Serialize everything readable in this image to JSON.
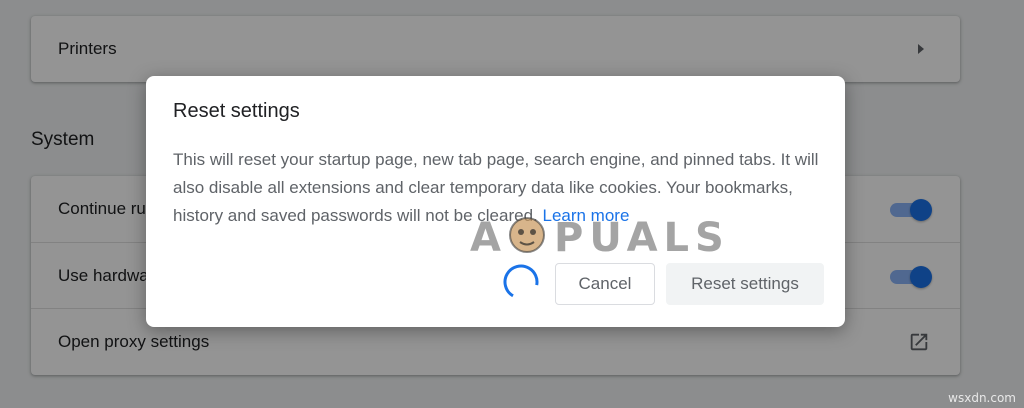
{
  "settings": {
    "printers_label": "Printers",
    "section_title": "System",
    "rows": [
      {
        "label": "Continue running background apps when Google Chrome is closed",
        "toggle_on": true
      },
      {
        "label": "Use hardware acceleration when available",
        "toggle_on": true
      },
      {
        "label": "Open proxy settings",
        "icon": "external-link-icon"
      }
    ]
  },
  "dialog": {
    "title": "Reset settings",
    "body": "This will reset your startup page, new tab page, search engine, and pinned tabs. It will also disable all extensions and clear temporary data like cookies. Your bookmarks, history and saved passwords will not be cleared.",
    "learn_more": "Learn more",
    "cancel_label": "Cancel",
    "reset_label": "Reset settings",
    "loading": true
  },
  "watermark": {
    "logo_text": "APPUALS",
    "site": "wsxdn.com"
  },
  "colors": {
    "accent": "#1a73e8",
    "toggle_track": "#8ab4f8",
    "overlay": "rgba(0,0,0,0.42)"
  },
  "icons": [
    "arrow-right-icon",
    "toggle-switch",
    "external-link-icon",
    "loading-spinner-icon"
  ]
}
